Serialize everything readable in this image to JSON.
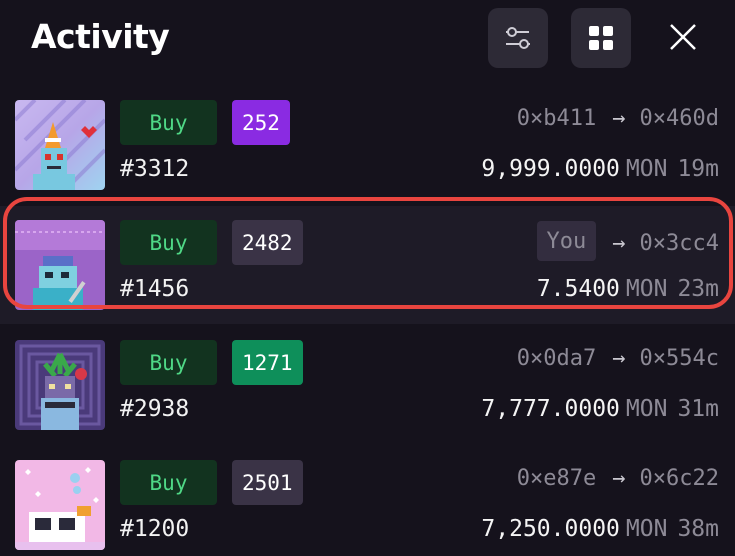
{
  "header": {
    "title": "Activity",
    "filter_icon": "sliders-icon",
    "grid_icon": "grid-icon",
    "close_icon": "close-icon"
  },
  "colors": {
    "background": "#15121c",
    "buy_bg": "#12331f",
    "buy_text": "#4fd886",
    "highlight": "#e9453f",
    "rank_purple": "#8a2be2",
    "rank_green": "#0e8f5a",
    "rank_gray": "#3a3346"
  },
  "activity": [
    {
      "type": "Buy",
      "rank": "252",
      "rank_color": "purple",
      "token": "#3312",
      "from": "0×b411",
      "to": "0×460d",
      "amount": "9,999.0000",
      "currency": "MON",
      "time": "19m",
      "thumb_icon": "nft-thumbnail-icon"
    },
    {
      "type": "Buy",
      "rank": "2482",
      "rank_color": "gray",
      "token": "#1456",
      "from": "You",
      "to": "0×3cc4",
      "amount": "7.5400",
      "currency": "MON",
      "time": "23m",
      "thumb_icon": "nft-thumbnail-icon"
    },
    {
      "type": "Buy",
      "rank": "1271",
      "rank_color": "green",
      "token": "#2938",
      "from": "0×0da7",
      "to": "0×554c",
      "amount": "7,777.0000",
      "currency": "MON",
      "time": "31m",
      "thumb_icon": "nft-thumbnail-icon"
    },
    {
      "type": "Buy",
      "rank": "2501",
      "rank_color": "gray",
      "token": "#1200",
      "from": "0×e87e",
      "to": "0×6c22",
      "amount": "7,250.0000",
      "currency": "MON",
      "time": "38m",
      "thumb_icon": "nft-thumbnail-icon"
    }
  ],
  "arrow_glyph": "→"
}
